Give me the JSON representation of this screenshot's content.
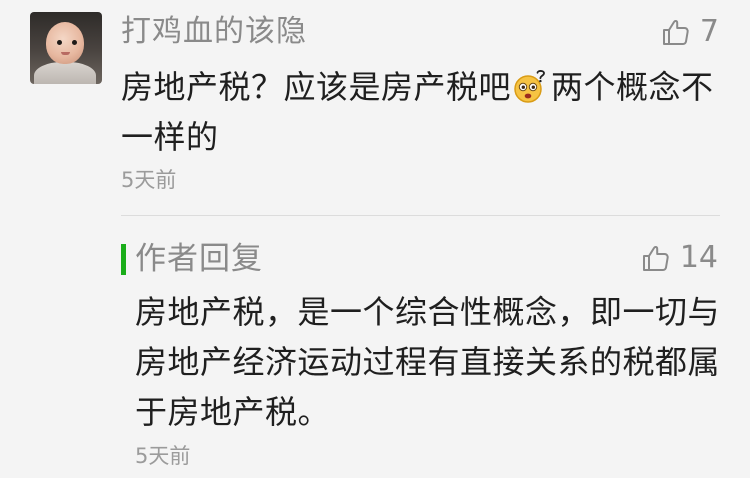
{
  "comment": {
    "username": "打鸡血的该隐",
    "likes": "7",
    "text_before_emoji": "房地产税？应该是房产税吧",
    "emoji_icon": "confused-face-emoji",
    "text_after_emoji": "两个概念不一样的",
    "time": "5天前"
  },
  "reply": {
    "label": "作者回复",
    "likes": "14",
    "text": "房地产税，是一个综合性概念，即一切与房地产经济运动过程有直接关系的税都属于房地产税。",
    "time": "5天前"
  },
  "colors": {
    "reply_accent": "#1aad19",
    "secondary_text": "#8a8a8a",
    "primary_text": "#1f1f1f",
    "background": "#f4f4f4"
  }
}
